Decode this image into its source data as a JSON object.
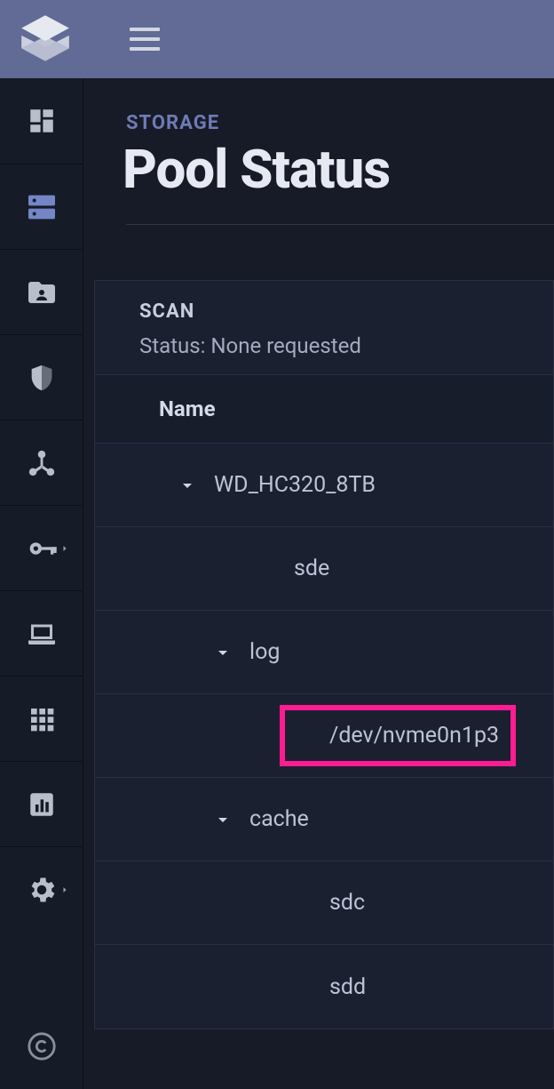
{
  "overline": "STORAGE",
  "page_title": "Pool Status",
  "panel": {
    "section_label": "SCAN",
    "status_line": "Status: None requested",
    "column_header": "Name"
  },
  "tree": [
    {
      "depth": 0,
      "expander": true,
      "label": "WD_HC320_8TB"
    },
    {
      "depth": 1,
      "expander": false,
      "label": "sde"
    },
    {
      "depth": 1,
      "expander": true,
      "label": "log"
    },
    {
      "depth": 2,
      "expander": false,
      "label": "/dev/nvme0n1p3",
      "highlight": true
    },
    {
      "depth": 1,
      "expander": true,
      "label": "cache"
    },
    {
      "depth": 2,
      "expander": false,
      "label": "sdc"
    },
    {
      "depth": 2,
      "expander": false,
      "label": "sdd"
    }
  ],
  "sidebar_icons": [
    "dashboard-icon",
    "storage-icon",
    "folder-person-icon",
    "shield-icon",
    "share-icon",
    "key-icon",
    "laptop-icon",
    "apps-grid-icon",
    "bar-chart-icon",
    "gear-icon"
  ]
}
